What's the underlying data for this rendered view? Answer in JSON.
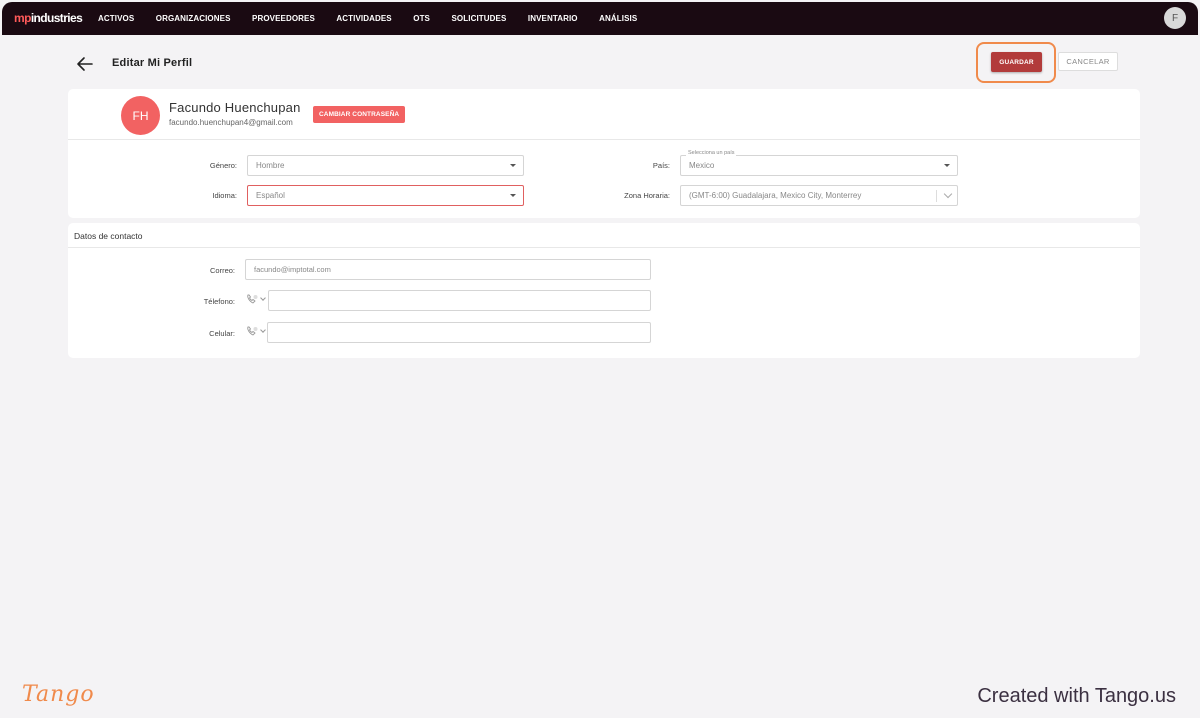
{
  "nav": {
    "logo_prefix": "mp",
    "logo_suffix": "industries",
    "items": [
      "ACTIVOS",
      "ORGANIZACIONES",
      "PROVEEDORES",
      "ACTIVIDADES",
      "OTS",
      "SOLICITUDES",
      "INVENTARIO",
      "ANÁLISIS"
    ],
    "user_initial": "F"
  },
  "header": {
    "title": "Editar Mi Perfil",
    "save_label": "GUARDAR",
    "cancel_label": "CANCELAR"
  },
  "profile": {
    "initials": "FH",
    "name": "Facundo Huenchupan",
    "email": "facundo.huenchupan4@gmail.com",
    "change_password_label": "CAMBIAR CONTRASEÑA",
    "gender_label": "Género:",
    "gender_value": "Hombre",
    "language_label": "Idioma:",
    "language_value": "Español",
    "country_label": "País:",
    "country_float_label": "Selecciona un país",
    "country_value": "Mexico",
    "timezone_label": "Zona Horaria:",
    "timezone_value": "(GMT-6:00) Guadalajara, Mexico City, Monterrey"
  },
  "contact": {
    "section_title": "Datos de contacto",
    "email_label": "Correo:",
    "email_value": "facundo@imptotal.com",
    "phone_label": "Télefono:",
    "phone_value": "",
    "mobile_label": "Celular:",
    "mobile_value": ""
  },
  "footer": {
    "brand": "Tango",
    "credit": "Created with Tango.us"
  },
  "colors": {
    "nav_bg": "#1a0a12",
    "accent": "#f26262",
    "save_bg": "#b23b3b",
    "highlight": "#f08a4b"
  }
}
